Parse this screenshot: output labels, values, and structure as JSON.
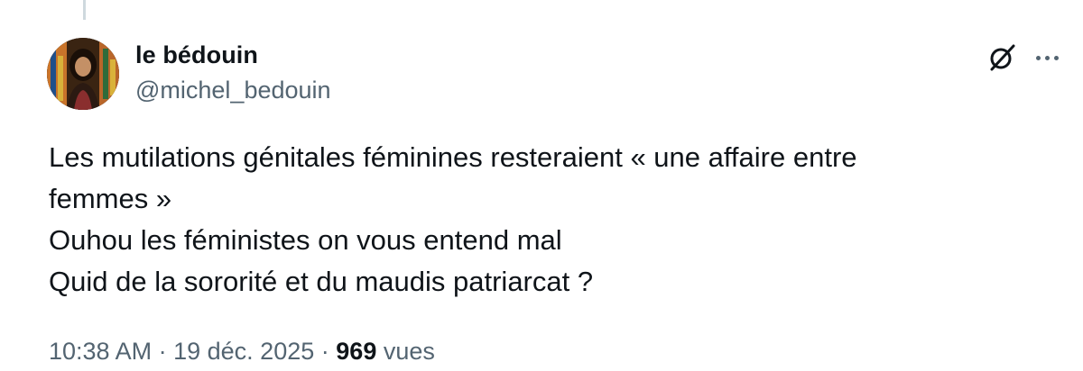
{
  "author": {
    "display_name": "le bédouin",
    "handle": "@michel_bedouin"
  },
  "icons": {
    "grok": "grok-icon",
    "more": "more-options-icon"
  },
  "tweet": {
    "lines": [
      "Les mutilations génitales féminines resteraient « une affaire entre",
      "femmes »",
      "Ouhou les féministes on vous entend mal",
      "Quid de la sororité et du maudis patriarcat ?"
    ]
  },
  "meta": {
    "time": "10:38 AM",
    "separator": "·",
    "date": "19 déc. 2025",
    "views_count": "969",
    "views_label": "vues"
  },
  "colors": {
    "text": "#0f1419",
    "secondary": "#536471",
    "thread_line": "#cfd9de"
  }
}
